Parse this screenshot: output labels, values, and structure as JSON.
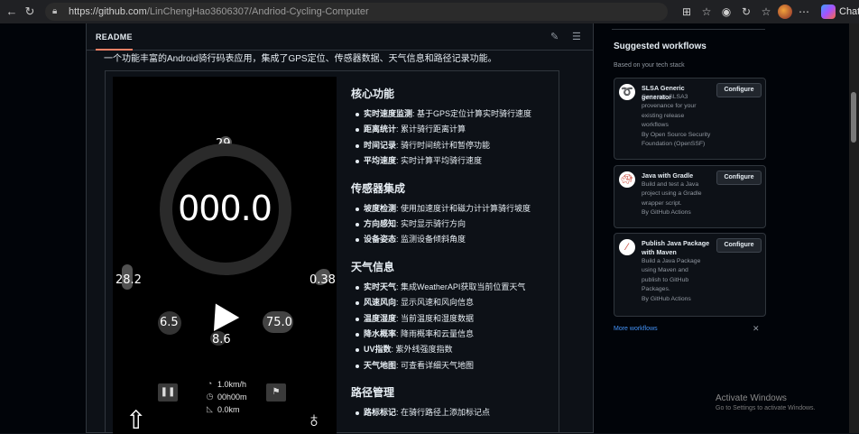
{
  "browser": {
    "url_host": "https://github.com",
    "url_path": "/LinChengHao3606307/Andriod-Cycling-Computer",
    "chat_label": "Chat"
  },
  "readme": {
    "tab_label": "README",
    "intro": "一个功能丰富的Android骑行码表应用，集成了GPS定位、传感器数据、天气信息和路径记录功能。"
  },
  "phone": {
    "top_value": "29",
    "speed": "000.0",
    "left_value": "28.2",
    "right_value": "0.38",
    "temp_left": "6.5",
    "temp_right": "75.0",
    "bottom_value": "8.6",
    "stats": {
      "speed_avg": "1.0km/h",
      "time": "00h00m",
      "distance": "0.0km"
    }
  },
  "features": {
    "sections": [
      {
        "title": "核心功能",
        "items": [
          {
            "bold": "实时速度监测",
            "text": ": 基于GPS定位计算实时骑行速度"
          },
          {
            "bold": "距离统计",
            "text": ": 累计骑行距离计算"
          },
          {
            "bold": "时间记录",
            "text": ": 骑行时间统计和暂停功能"
          },
          {
            "bold": "平均速度",
            "text": ": 实时计算平均骑行速度"
          }
        ]
      },
      {
        "title": "传感器集成",
        "items": [
          {
            "bold": "坡度检测",
            "text": ": 使用加速度计和磁力计计算骑行坡度"
          },
          {
            "bold": "方向感知",
            "text": ": 实时显示骑行方向"
          },
          {
            "bold": "设备姿态",
            "text": ": 监测设备倾斜角度"
          }
        ]
      },
      {
        "title": "天气信息",
        "items": [
          {
            "bold": "实时天气",
            "text": ": 集成WeatherAPI获取当前位置天气"
          },
          {
            "bold": "风速风向",
            "text": ": 显示风速和风向信息"
          },
          {
            "bold": "温度湿度",
            "text": ": 当前温度和湿度数据"
          },
          {
            "bold": "降水概率",
            "text": ": 降雨概率和云量信息"
          },
          {
            "bold": "UV指数",
            "text": ": 紫外线强度指数"
          },
          {
            "bold": "天气地图",
            "text": ": 可查看详细天气地图"
          }
        ]
      },
      {
        "title": "路径管理",
        "items": [
          {
            "bold": "路标标记",
            "text": ": 在骑行路径上添加标记点"
          }
        ]
      }
    ]
  },
  "sidebar": {
    "title": "Suggested workflows",
    "subtitle": "Based on your tech stack",
    "workflows": [
      {
        "title": "SLSA Generic generator",
        "desc": [
          "Generate SLSA3",
          "provenance for your",
          "existing release",
          "workflows"
        ],
        "by": [
          "By Open Source Security",
          "Foundation (OpenSSF)"
        ],
        "button": "Configure",
        "icon": "slsa-icon"
      },
      {
        "title": "Java with Gradle",
        "desc": [
          "Build and test a Java",
          "project using a Gradle",
          "wrapper script."
        ],
        "by": [
          "By GitHub Actions"
        ],
        "button": "Configure",
        "icon": "gradle-icon"
      },
      {
        "title": "Publish Java Package with Maven",
        "desc": [
          "Build a Java Package",
          "using Maven and",
          "publish to GitHub",
          "Packages."
        ],
        "by": [
          "By GitHub Actions"
        ],
        "button": "Configure",
        "icon": "maven-icon"
      }
    ],
    "more_label": "More workflows"
  },
  "os": {
    "activate_title": "Activate Windows",
    "activate_sub": "Go to Settings to activate Windows."
  },
  "colors": {
    "accent_tab": "#f78166",
    "link": "#4493f8",
    "bg": "#0d1117"
  }
}
